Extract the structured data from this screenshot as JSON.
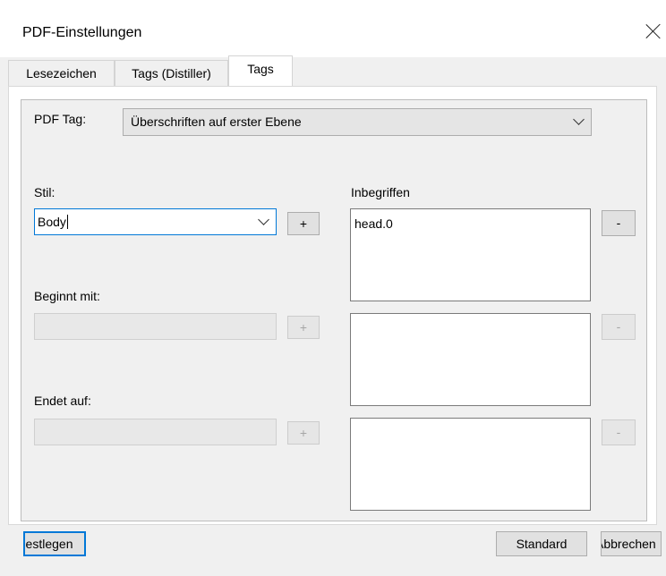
{
  "window": {
    "title": "PDF-Einstellungen"
  },
  "tabs": [
    {
      "label": "Lesezeichen",
      "active": false
    },
    {
      "label": "Tags (Distiller)",
      "active": false
    },
    {
      "label": "Tags",
      "active": true
    }
  ],
  "pdf_tag": {
    "label": "PDF Tag:",
    "value": "Überschriften auf erster Ebene"
  },
  "style": {
    "label": "Stil:",
    "value": "Body",
    "add_label": "+"
  },
  "includes": {
    "label": "Inbegriffen",
    "items": [
      "head.0"
    ],
    "remove_label": "-"
  },
  "begins": {
    "label": "Beginnt mit:",
    "value": "",
    "add_label": "+",
    "remove_label": "-"
  },
  "ends": {
    "label": "Endet auf:",
    "value": "",
    "add_label": "+",
    "remove_label": "-"
  },
  "footer": {
    "apply_label": "Festlegen",
    "standard_label": "Standard",
    "cancel_label": "Abbrechen"
  },
  "colors": {
    "focus": "#0078d7",
    "window": "#f0f0f0",
    "disabled_text": "#a6a6a6"
  }
}
